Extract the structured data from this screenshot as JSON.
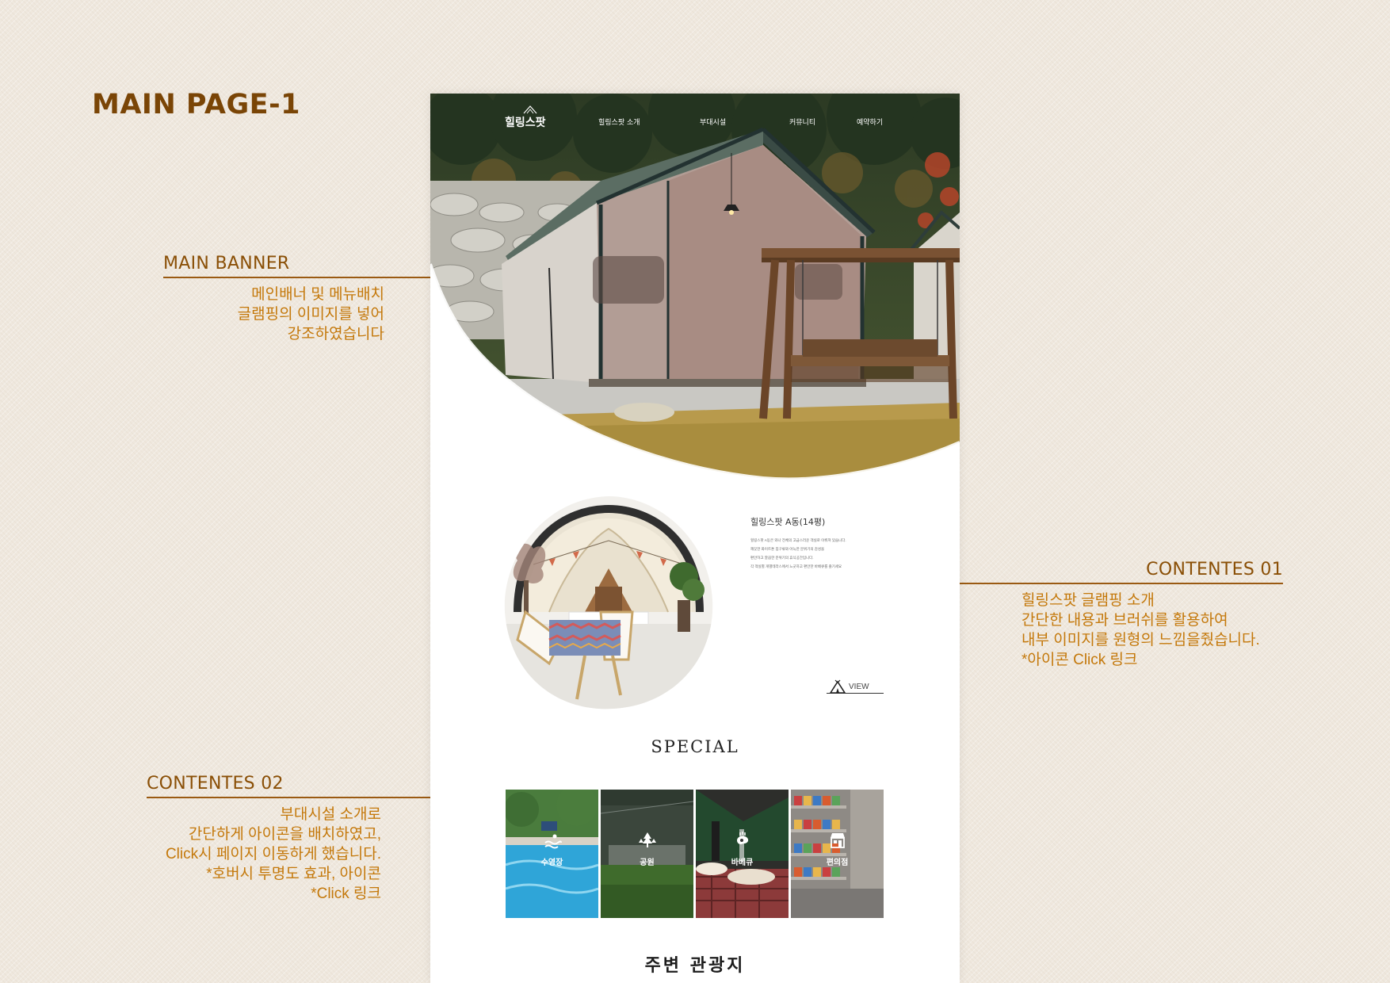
{
  "page_heading": "MAIN PAGE-1",
  "annotations": {
    "main_banner": {
      "title": "MAIN BANNER",
      "lines": [
        "메인배너 및 메뉴배치",
        "글램핑의 이미지를 넣어",
        "강조하였습니다"
      ]
    },
    "contents_01": {
      "title": "CONTENTES 01",
      "lines": [
        "힐링스팟  글램핑 소개",
        "간단한 내용과 브러쉬를 활용하여",
        "내부 이미지를 원형의 느낌을줬습니다.",
        "*아이콘 Click 링크"
      ]
    },
    "contents_02": {
      "title": "CONTENTES 02",
      "lines": [
        "부대시설 소개로",
        "간단하게 아이콘을 배치하였고,",
        "Click시 페이지 이동하게 했습니다.",
        "*호버시 투명도 효과, 아이콘",
        "*Click 링크"
      ]
    }
  },
  "site": {
    "logo": "힐링스팟",
    "nav": [
      "힐링스팟 소개",
      "부대시설",
      "커뮤니티",
      "예약하기"
    ],
    "room": {
      "title": "힐링스팟 A동(14평)",
      "desc": [
        "힐링스팟 A동은 와나 전체의 고급스러운 객실로 이뤄져 있습니다.",
        "깨끗한 화이트톤 침구류와 아늑한 분위기의 감성을",
        "편안하고 깔끔한 분위기의 휴식공간입니다.",
        "각 객실별 개별테라스에서 느긋하고 편안한 바베큐를 즐기세요"
      ],
      "view_label": "VIEW"
    },
    "special_title": "SPECIAL",
    "facilities": [
      {
        "label": "수영장",
        "icon": "pool-icon"
      },
      {
        "label": "공원",
        "icon": "tree-icon"
      },
      {
        "label": "바베큐",
        "icon": "bbq-icon"
      },
      {
        "label": "편의점",
        "icon": "store-icon"
      }
    ],
    "nearby_title": "주변 관광지"
  },
  "colors": {
    "background": "#efe8de",
    "annotation_title": "#8a4f06",
    "annotation_body": "#c4780a",
    "mockup_bg": "#ffffff"
  }
}
